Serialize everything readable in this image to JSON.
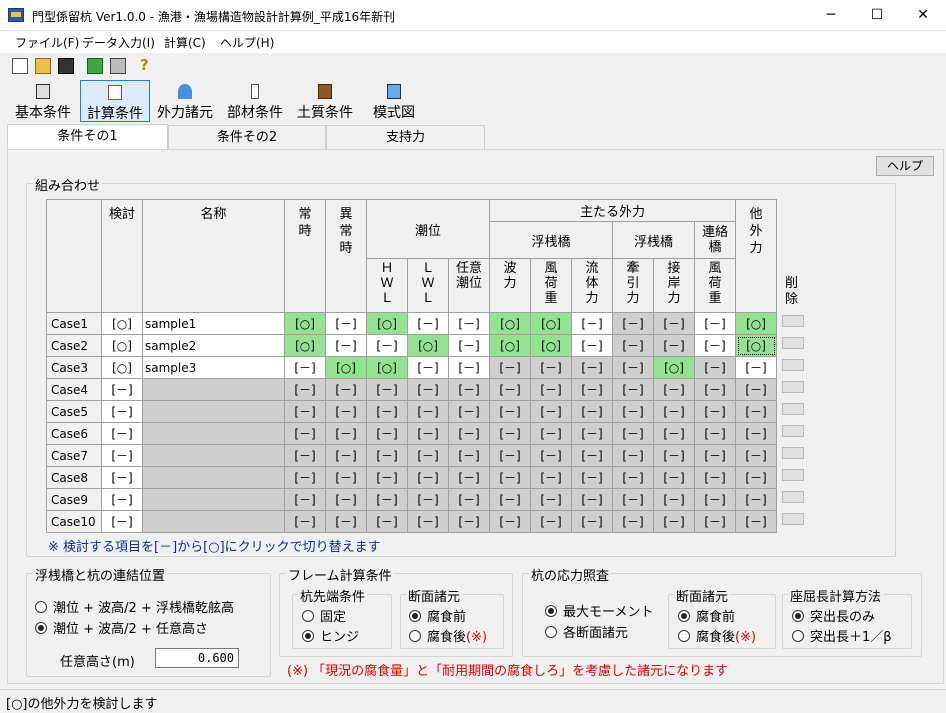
{
  "window": {
    "title": "門型係留杭 Ver1.0.0 - 漁港・漁場構造物設計計算例_平成16年新刊",
    "minimize": "─",
    "maximize": "☐",
    "close": "✕"
  },
  "menu": [
    "ファイル(F)",
    "データ入力(I)",
    "計算(C)",
    "ヘルプ(H)"
  ],
  "toolbar_icons": [
    "new-file-icon",
    "open-folder-icon",
    "save-icon",
    "preview-icon",
    "print-icon",
    "help-question-icon"
  ],
  "big_buttons": [
    {
      "label": "基本条件",
      "icon": "building-icon"
    },
    {
      "label": "計算条件",
      "icon": "calculator-icon",
      "active": true
    },
    {
      "label": "外力諸元",
      "icon": "wave-icon"
    },
    {
      "label": "部材条件",
      "icon": "pile-icon"
    },
    {
      "label": "土質条件",
      "icon": "soil-icon"
    },
    {
      "label": "模式図",
      "icon": "diagram-icon"
    }
  ],
  "tabs": [
    "条件その1",
    "条件その2",
    "支持力"
  ],
  "help_button": "ヘルプ",
  "combination": {
    "title": "組み合わせ",
    "headers": {
      "check": "検討",
      "name": "名称",
      "normal": "常\n時",
      "abnormal": "異\n常\n時",
      "tide": "潮位",
      "hwl": "Ｈ\nＷ\nＬ",
      "lwl": "Ｌ\nＷ\nＬ",
      "any_tide": "任意\n潮位",
      "main_force": "主たる外力",
      "floating1": "浮桟橋",
      "floating2": "浮桟橋",
      "bridge": "連絡\n橋",
      "wave": "波\n力",
      "wind1": "風\n荷\n重",
      "current": "流\n体\n力",
      "tow": "牽\n引\n力",
      "berth": "接\n岸\n力",
      "wind2": "風\n荷\n重",
      "other": "他\n外\n力",
      "delete": "削\n除"
    },
    "rows": [
      {
        "case": "Case1",
        "check": "[○]",
        "name": "sample1",
        "vals": [
          "[○]",
          "[－]",
          "[○]",
          "[－]",
          "[－]",
          "[○]",
          "[○]",
          "[－]",
          "[－]",
          "[－]",
          "[－]",
          "[○]"
        ],
        "st": [
          "on",
          "w",
          "on",
          "w",
          "w",
          "on",
          "on",
          "w",
          "g",
          "g",
          "w",
          "on"
        ]
      },
      {
        "case": "Case2",
        "check": "[○]",
        "name": "sample2",
        "vals": [
          "[○]",
          "[－]",
          "[－]",
          "[○]",
          "[－]",
          "[○]",
          "[○]",
          "[－]",
          "[－]",
          "[－]",
          "[－]",
          "[○]"
        ],
        "st": [
          "on",
          "w",
          "w",
          "on",
          "w",
          "on",
          "on",
          "w",
          "g",
          "g",
          "w",
          "on sel"
        ]
      },
      {
        "case": "Case3",
        "check": "[○]",
        "name": "sample3",
        "vals": [
          "[－]",
          "[○]",
          "[○]",
          "[－]",
          "[－]",
          "[－]",
          "[－]",
          "[－]",
          "[－]",
          "[○]",
          "[－]",
          "[－]"
        ],
        "st": [
          "w",
          "on",
          "on",
          "w",
          "w",
          "g",
          "g",
          "g",
          "g",
          "on",
          "g",
          "w"
        ]
      },
      {
        "case": "Case4",
        "check": "[－]",
        "name": "",
        "vals": [
          "[－]",
          "[－]",
          "[－]",
          "[－]",
          "[－]",
          "[－]",
          "[－]",
          "[－]",
          "[－]",
          "[－]",
          "[－]",
          "[－]"
        ]
      },
      {
        "case": "Case5",
        "check": "[－]",
        "name": "",
        "vals": [
          "[－]",
          "[－]",
          "[－]",
          "[－]",
          "[－]",
          "[－]",
          "[－]",
          "[－]",
          "[－]",
          "[－]",
          "[－]",
          "[－]"
        ]
      },
      {
        "case": "Case6",
        "check": "[－]",
        "name": "",
        "vals": [
          "[－]",
          "[－]",
          "[－]",
          "[－]",
          "[－]",
          "[－]",
          "[－]",
          "[－]",
          "[－]",
          "[－]",
          "[－]",
          "[－]"
        ]
      },
      {
        "case": "Case7",
        "check": "[－]",
        "name": "",
        "vals": [
          "[－]",
          "[－]",
          "[－]",
          "[－]",
          "[－]",
          "[－]",
          "[－]",
          "[－]",
          "[－]",
          "[－]",
          "[－]",
          "[－]"
        ]
      },
      {
        "case": "Case8",
        "check": "[－]",
        "name": "",
        "vals": [
          "[－]",
          "[－]",
          "[－]",
          "[－]",
          "[－]",
          "[－]",
          "[－]",
          "[－]",
          "[－]",
          "[－]",
          "[－]",
          "[－]"
        ]
      },
      {
        "case": "Case9",
        "check": "[－]",
        "name": "",
        "vals": [
          "[－]",
          "[－]",
          "[－]",
          "[－]",
          "[－]",
          "[－]",
          "[－]",
          "[－]",
          "[－]",
          "[－]",
          "[－]",
          "[－]"
        ]
      },
      {
        "case": "Case10",
        "check": "[－]",
        "name": "",
        "vals": [
          "[－]",
          "[－]",
          "[－]",
          "[－]",
          "[－]",
          "[－]",
          "[－]",
          "[－]",
          "[－]",
          "[－]",
          "[－]",
          "[－]"
        ]
      }
    ],
    "note": "※ 検討する項目を[－]から[○]にクリックで切り替えます"
  },
  "connection": {
    "title": "浮桟橋と杭の連結位置",
    "options": [
      "潮位 + 波高/2 + 浮桟橋乾舷高",
      "潮位 + 波高/2 + 任意高さ"
    ],
    "selected": 1,
    "height_label": "任意高さ(m)",
    "height_value": "0.600"
  },
  "frame": {
    "title": "フレーム計算条件",
    "pile_tip": {
      "title": "杭先端条件",
      "options": [
        "固定",
        "ヒンジ"
      ],
      "selected": 1
    },
    "section": {
      "title": "断面諸元",
      "options": [
        "腐食前",
        "腐食後"
      ],
      "mark": "(※)",
      "selected": 0
    }
  },
  "stress": {
    "title": "杭の応力照査",
    "options": [
      "最大モーメント",
      "各断面諸元"
    ],
    "selected": 0,
    "section": {
      "title": "断面諸元",
      "options": [
        "腐食前",
        "腐食後"
      ],
      "mark": "(※)",
      "selected": 0
    },
    "buckling": {
      "title": "座屈長計算方法",
      "options": [
        "突出長のみ",
        "突出長＋1／β"
      ],
      "selected": 0
    }
  },
  "footnote": "(※) 「現況の腐食量」と「耐用期間の腐食しろ」を考慮した諸元になります",
  "status": "[○]の他外力を検討します",
  "colors": {
    "on": "#93e292",
    "disabled": "#cfcfcf",
    "note_blue": "#0b2ea0",
    "footnote_red": "#e00000"
  }
}
